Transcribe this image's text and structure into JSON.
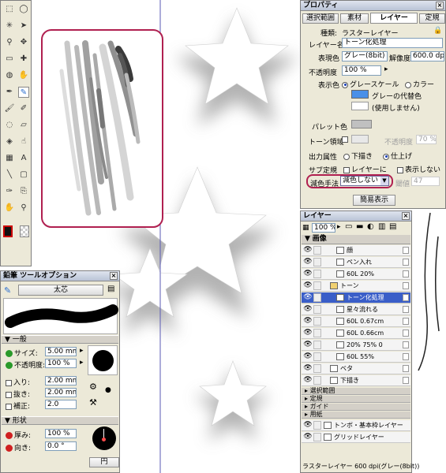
{
  "canvas": {
    "bg": "#ffffff",
    "guide_color": "#5a5ab4",
    "highlight_color": "#b02050"
  },
  "tools": {
    "icons": [
      "marquee-icon",
      "lasso-icon",
      "wand-icon",
      "pointer-icon",
      "magnifier-icon",
      "move-icon",
      "ruler-icon",
      "crosshair-icon",
      "fill-bucket-icon",
      "hand-icon",
      "pen-icon",
      "pencil-icon",
      "brush-icon",
      "marker-icon",
      "airbrush-icon",
      "eraser-icon",
      "blend-icon",
      "smudge-icon",
      "gradient-icon",
      "text-icon",
      "line-icon",
      "rectangle-icon",
      "eyedropper-icon",
      "stamp-icon",
      "hand-grab-icon",
      "zoom-icon"
    ]
  },
  "tool_options": {
    "title": "鉛筆 ツールオプション",
    "preset": "太芯",
    "section_general": "一般",
    "size_label": "サイズ:",
    "size_value": "5.00 mm",
    "opacity_label": "不透明度:",
    "opacity_value": "100 %",
    "in_label": "入り:",
    "in_value": "2.00 mm",
    "out_label": "抜き:",
    "out_value": "2.00 mm",
    "correct_label": "補正:",
    "correct_value": "2.0",
    "section_shape": "形状",
    "thickness_label": "厚み:",
    "thickness_value": "100 %",
    "direction_label": "向き:",
    "direction_value": "0.0 °",
    "shape_button": "円"
  },
  "properties": {
    "title": "プロパティ",
    "tabs": [
      "選択範囲",
      "素材",
      "レイヤー",
      "定規"
    ],
    "kind_label": "種類:",
    "kind_value": "ラスターレイヤー",
    "name_label": "レイヤー名",
    "name_value": "トーン化処理",
    "expression_label": "表現色",
    "expression_value": "グレー(8bit)",
    "resolution_label": "解像度",
    "resolution_value": "600.0 dpi",
    "opacity_label": "不透明度",
    "opacity_value": "100 %",
    "display_color_label": "表示色",
    "grayscale_label": "グレースケール",
    "color_label": "カラー",
    "gray_sub_label": "グレーの代替色",
    "unused_label": "(使用しません)",
    "swatch_color": "#4a90e8",
    "palette_label": "パレット色",
    "tone_area_label": "トーン領域",
    "tone_opacity_label": "不透明度",
    "tone_opacity_value": "70 %",
    "output_label": "出力属性",
    "draft_label": "下描き",
    "finish_label": "仕上げ",
    "subruler_label": "サブ定規",
    "layer_label": "レイヤーに",
    "hide_label": "表示しない",
    "reduce_label": "減色手法",
    "reduce_value": "減色しない",
    "threshold_label": "閾値",
    "threshold_value": "47",
    "simple_button": "簡易表示"
  },
  "layers": {
    "title": "レイヤー",
    "zoom_value": "100 %",
    "folder_label": "画像",
    "rows": [
      {
        "name": "顔",
        "selected": false,
        "indent": 2
      },
      {
        "name": "ペン入れ",
        "selected": false,
        "indent": 2
      },
      {
        "name": "60L 20%",
        "selected": false,
        "indent": 2
      },
      {
        "name": "トーン",
        "selected": false,
        "indent": 1
      },
      {
        "name": "トーン化処理",
        "selected": true,
        "indent": 2
      },
      {
        "name": "星々流れる",
        "selected": false,
        "indent": 2
      },
      {
        "name": "60L 0.67cm",
        "selected": false,
        "indent": 2
      },
      {
        "name": "60L 0.66cm",
        "selected": false,
        "indent": 2
      },
      {
        "name": "20% 75% 0",
        "selected": false,
        "indent": 2
      },
      {
        "name": "60L 55%",
        "selected": false,
        "indent": 2
      },
      {
        "name": "ベタ",
        "selected": false,
        "indent": 1
      },
      {
        "name": "下描き",
        "selected": false,
        "indent": 1
      }
    ],
    "groups": [
      "選択範囲",
      "定規",
      "ガイド",
      "用紙"
    ],
    "bottom_rows": [
      "トンボ・基本枠レイヤー",
      "グリッドレイヤー"
    ],
    "status": "ラスターレイヤー 600 dpi(グレー(8bit))"
  }
}
